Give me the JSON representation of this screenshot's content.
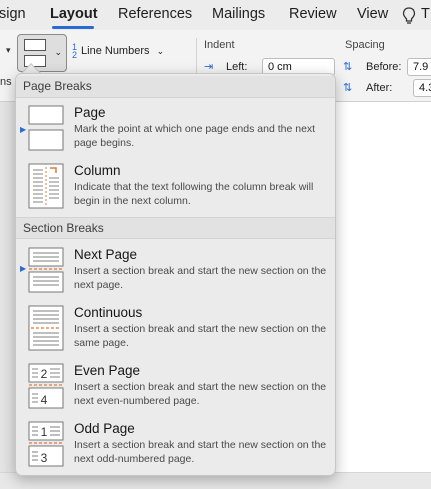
{
  "ribbon_tabs": [
    "sign",
    "Layout",
    "References",
    "Mailings",
    "Review",
    "View"
  ],
  "ribbon": {
    "cut_label": "ns",
    "line_numbers": "Line Numbers",
    "indent": {
      "label": "Indent",
      "left_label": "Left:",
      "left_value": "0 cm"
    },
    "spacing": {
      "label": "Spacing",
      "before_label": "Before:",
      "before_value": "7.9",
      "after_label": "After:",
      "after_value": "4.3"
    }
  },
  "menu": {
    "page_breaks_header": "Page Breaks",
    "section_breaks_header": "Section Breaks",
    "items": [
      {
        "title": "Page",
        "desc": "Mark the point at which one page ends and the next page begins."
      },
      {
        "title": "Column",
        "desc": "Indicate that the text following the column break will begin in the next column."
      },
      {
        "title": "Next Page",
        "desc": "Insert a section break and start the new section on the next page."
      },
      {
        "title": "Continuous",
        "desc": "Insert a section break and start the new section on the same page."
      },
      {
        "title": "Even Page",
        "desc": "Insert a section break and start the new section on the next even-numbered page."
      },
      {
        "title": "Odd Page",
        "desc": "Insert a section break and start the new section on the next odd-numbered page."
      }
    ],
    "icon_numbers": {
      "even_top": "2",
      "even_bottom": "4",
      "odd_top": "1",
      "odd_bottom": "3"
    }
  },
  "colors": {
    "accent": "#2b6ad6",
    "break_marker": "#e07b39"
  }
}
